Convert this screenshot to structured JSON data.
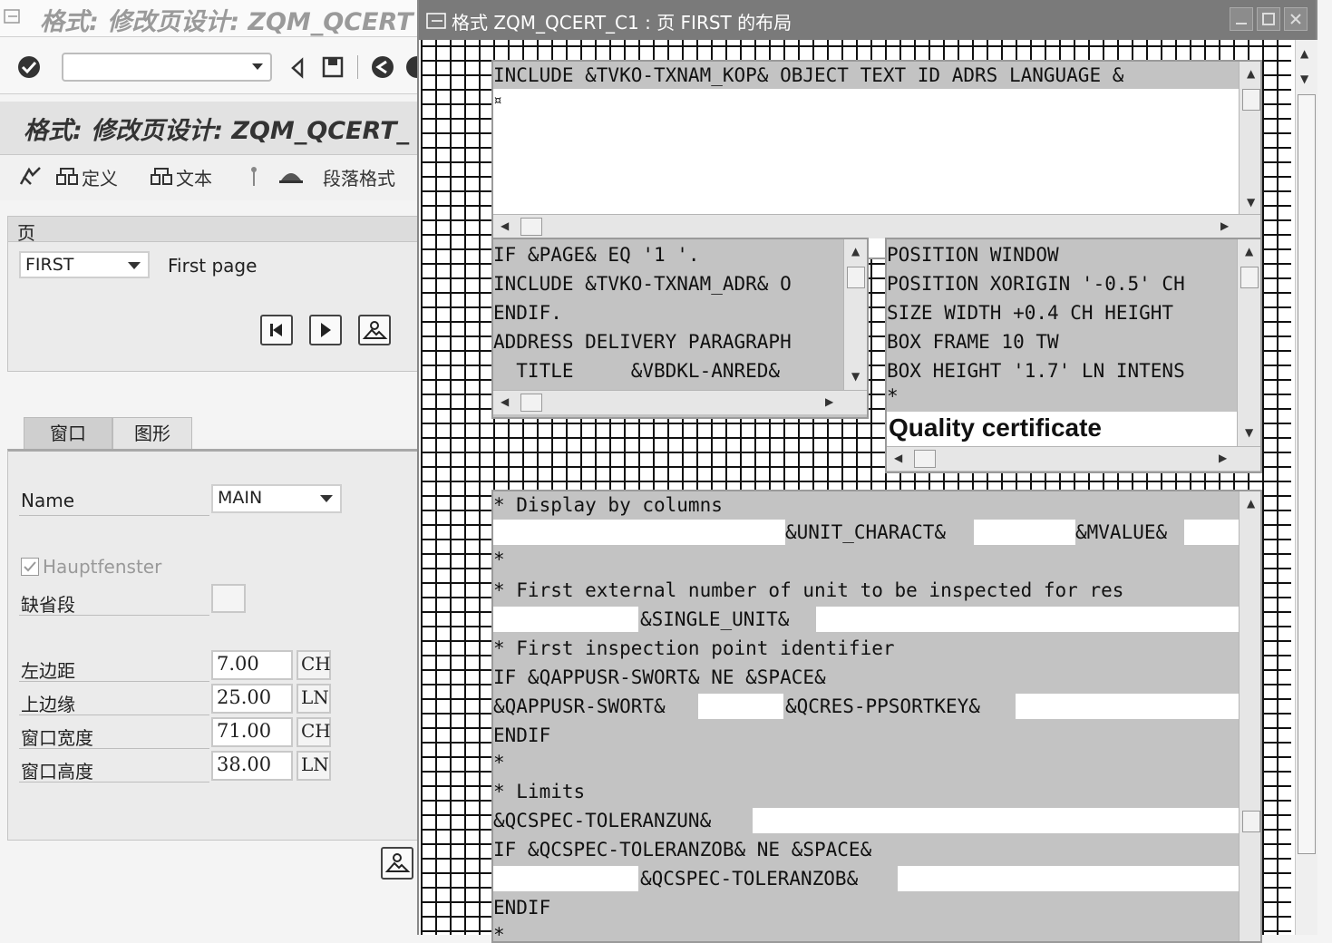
{
  "background_window": {
    "title": "格式: 修改页设计: ZQM_QCERT",
    "app_title": "格式: 修改页设计: ZQM_QCERT_",
    "toolbar": {
      "command_field_value": "",
      "definition_label": "定义",
      "text_label": "文本",
      "paragraph_format_label": "段落格式"
    },
    "page_section": {
      "header": "页",
      "page_value": "FIRST",
      "page_description": "First page"
    },
    "tabs": [
      {
        "label": "窗口",
        "active": true
      },
      {
        "label": "图形",
        "active": false
      }
    ],
    "window_section": {
      "name_label": "Name",
      "name_value": "MAIN",
      "main_window_label": "Hauptfenster",
      "main_window_checked": true,
      "default_para_label": "缺省段",
      "left_margin_label": "左边距",
      "left_margin_value": "7.00",
      "left_margin_unit": "CH",
      "upper_margin_label": "上边缘",
      "upper_margin_value": "25.00",
      "upper_margin_unit": "LN",
      "width_label": "窗口宽度",
      "width_value": "71.00",
      "width_unit": "CH",
      "height_label": "窗口高度",
      "height_value": "38.00",
      "height_unit": "LN"
    }
  },
  "dialog": {
    "title": "格式 ZQM_QCERT_C1 : 页 FIRST 的布局",
    "pane_top": {
      "line1": "INCLUDE &TVKO-TXNAM_KOP& OBJECT TEXT ID ADRS LANGUAGE &",
      "line2": "¤"
    },
    "pane_address": {
      "lines": [
        "IF &PAGE& EQ '1 '.",
        "INCLUDE &TVKO-TXNAM_ADR& O",
        "ENDIF.",
        "ADDRESS DELIVERY PARAGRAPH",
        "  TITLE     &VBDKL-ANRED&"
      ]
    },
    "pane_box": {
      "lines": [
        "POSITION WINDOW",
        "POSITION XORIGIN '-0.5' CH",
        "SIZE WIDTH +0.4 CH HEIGHT",
        "BOX FRAME 10 TW",
        "BOX HEIGHT '1.7' LN INTENS",
        "*"
      ],
      "heading": "Quality certificate"
    },
    "pane_main": {
      "l01": "* Display by columns",
      "l02": "&UNIT_CHARACT&",
      "l02b": "&MVALUE&",
      "l03": "*",
      "l04": "* First external number of unit to be inspected for res",
      "l05": "&SINGLE_UNIT&",
      "l06": "* First inspection point identifier",
      "l07": "IF &QAPPUSR-SWORT& NE &SPACE&",
      "l08": "&QAPPUSR-SWORT&",
      "l08b": "&QCRES-PPSORTKEY&",
      "l09": "ENDIF",
      "l10": "*",
      "l11": "* Limits",
      "l12": "&QCSPEC-TOLERANZUN&",
      "l13": "IF &QCSPEC-TOLERANZOB& NE &SPACE&",
      "l14": "&QCSPEC-TOLERANZOB&",
      "l15": "ENDIF",
      "l16": "*"
    }
  }
}
